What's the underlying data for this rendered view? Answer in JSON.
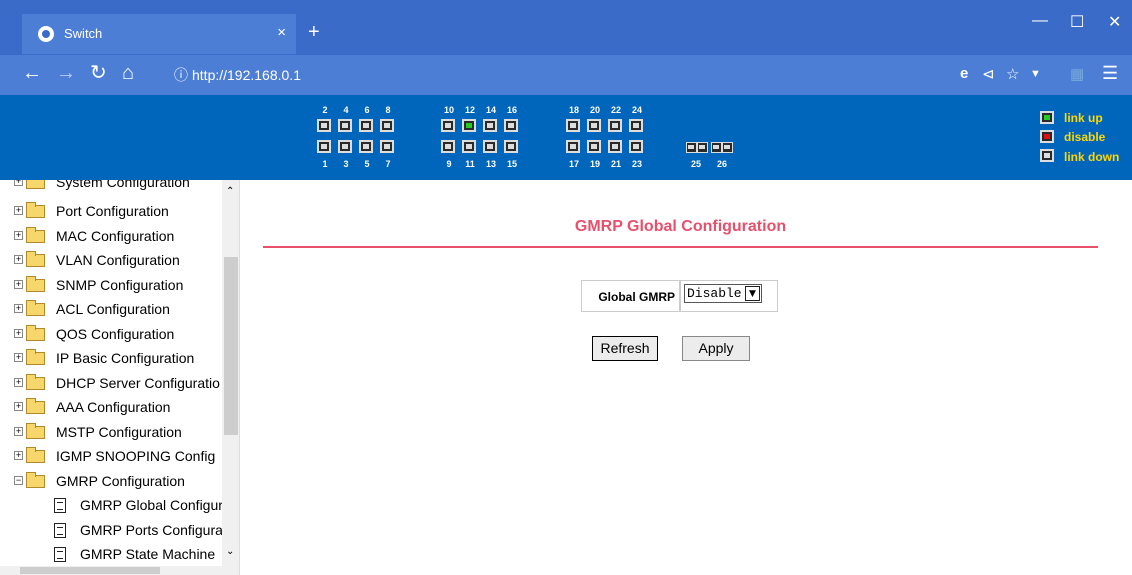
{
  "browser": {
    "tab_title": "Switch",
    "tab_close": "×",
    "new_tab": "+",
    "url": "http://192.168.0.1"
  },
  "ports": {
    "top_row": [
      "2",
      "4",
      "6",
      "8",
      "10",
      "12",
      "14",
      "16",
      "18",
      "20",
      "22",
      "24"
    ],
    "bottom_row": [
      "1",
      "3",
      "5",
      "7",
      "9",
      "11",
      "13",
      "15",
      "17",
      "19",
      "21",
      "23"
    ],
    "extra": [
      "25",
      "26"
    ],
    "status_colors": {
      "link_up": "#22cc22",
      "disable": "#dd1111",
      "link_down": "#dddddd"
    }
  },
  "legend": {
    "link_up": "link up",
    "disable": "disable",
    "link_down": "link down"
  },
  "sidebar": {
    "items": [
      {
        "label": "System Configuration"
      },
      {
        "label": "Port Configuration"
      },
      {
        "label": "MAC Configuration"
      },
      {
        "label": "VLAN Configuration"
      },
      {
        "label": "SNMP Configuration"
      },
      {
        "label": "ACL Configuration"
      },
      {
        "label": "QOS Configuration"
      },
      {
        "label": "IP Basic Configuration"
      },
      {
        "label": "DHCP Server Configuratio"
      },
      {
        "label": "AAA Configuration"
      },
      {
        "label": "MSTP Configuration"
      },
      {
        "label": "IGMP SNOOPING Config"
      },
      {
        "label": "GMRP Configuration"
      }
    ],
    "subitems": [
      {
        "label": "GMRP Global Configur"
      },
      {
        "label": "GMRP Ports Configura"
      },
      {
        "label": "GMRP State Machine"
      }
    ]
  },
  "main": {
    "title": "GMRP Global Configuration",
    "global_gmrp_label": "Global GMRP",
    "global_gmrp_value": "Disable",
    "refresh_label": "Refresh",
    "apply_label": "Apply",
    "accent_color": "#e8506b"
  }
}
